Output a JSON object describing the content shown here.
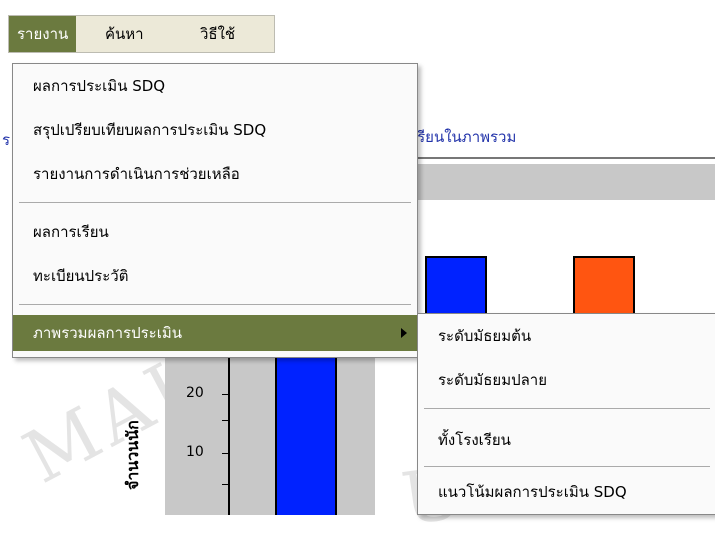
{
  "menubar": {
    "items": [
      {
        "label": "รายงาน",
        "active": true
      },
      {
        "label": "ค้นหา",
        "active": false
      },
      {
        "label": "วิธีใช้",
        "active": false
      }
    ]
  },
  "report_menu": {
    "items": [
      {
        "label": "ผลการประเมิน SDQ"
      },
      {
        "label": "สรุปเปรียบเทียบผลการประเมิน SDQ"
      },
      {
        "label": "รายงานการดำเนินการช่วยเหลือ"
      },
      {
        "label": "ผลการเรียน"
      },
      {
        "label": "ทะเบียนประวัติ"
      },
      {
        "label": "ภาพรวมผลการประเมิน",
        "has_submenu": true,
        "highlighted": true
      }
    ]
  },
  "submenu": {
    "items": [
      {
        "label": "ระดับมัธยมต้น"
      },
      {
        "label": "ระดับมัธยมปลาย"
      },
      {
        "label": "ทั้งโรงเรียน"
      },
      {
        "label": "แนวโน้มผลการประเมิน SDQ"
      }
    ]
  },
  "page": {
    "heading_fragment": "เรียนในภาพรวม",
    "left_fragment": "ร"
  },
  "chart_data": {
    "type": "bar",
    "ylabel": "จำนวนนัก",
    "yticks": [
      "20",
      "10"
    ],
    "series_colors": [
      "#0022ff",
      "#ff5511"
    ],
    "visible_bar_color": "#0022ff"
  }
}
